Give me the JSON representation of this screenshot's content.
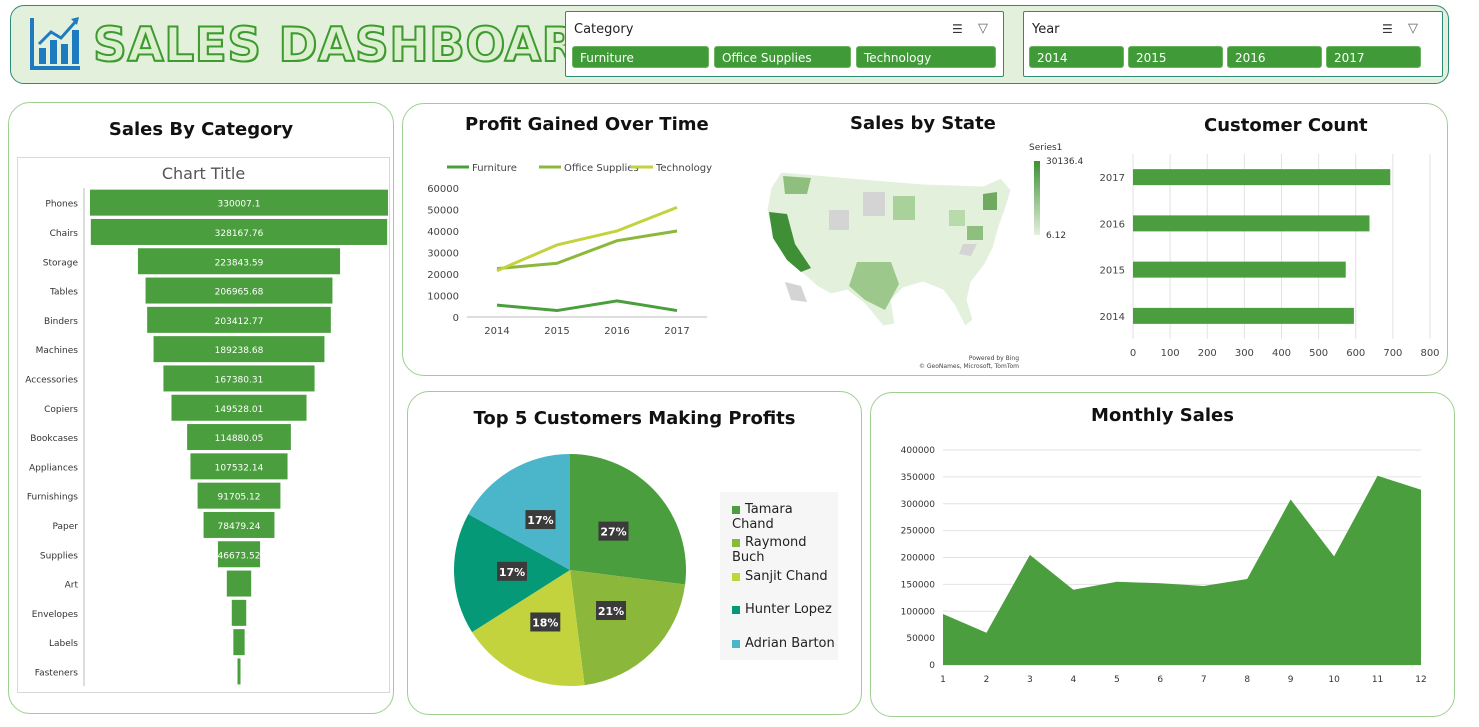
{
  "header": {
    "title": "SALES DASHBOARD",
    "category_slicer": {
      "title": "Category",
      "items": [
        "Furniture",
        "Office Supplies",
        "Technology"
      ]
    },
    "year_slicer": {
      "title": "Year",
      "items": [
        "2014",
        "2015",
        "2016",
        "2017"
      ]
    }
  },
  "colors": {
    "green": "#4a9e3d",
    "mid_green": "#8bb83a",
    "light_green": "#c3d33e",
    "teal": "#069978",
    "sky": "#4bb5c9",
    "map_dark": "#3f8f36",
    "map_light": "#e3f1dc"
  },
  "icons": [
    "bar-chart-logo-icon",
    "multi-select-icon",
    "clear-filter-icon"
  ],
  "chart_data": [
    {
      "id": "sales_by_category",
      "type": "bar",
      "panel_title": "Sales By Category",
      "title": "Chart Title",
      "orientation": "horizontal-funnel",
      "categories": [
        "Phones",
        "Chairs",
        "Storage",
        "Tables",
        "Binders",
        "Machines",
        "Accessories",
        "Copiers",
        "Bookcases",
        "Appliances",
        "Furnishings",
        "Paper",
        "Supplies",
        "Art",
        "Envelopes",
        "Labels",
        "Fasteners"
      ],
      "values": [
        330007.1,
        328167.76,
        223843.59,
        206965.68,
        203412.77,
        189238.68,
        167380.31,
        149528.01,
        114880.05,
        107532.14,
        91705.12,
        78479.24,
        46673.52,
        27000,
        16000,
        12500,
        3000
      ],
      "labels": [
        "330007.1",
        "328167.76",
        "223843.59",
        "206965.68",
        "203412.77",
        "189238.68",
        "167380.31",
        "149528.01",
        "114880.05",
        "107532.14",
        "91705.12",
        "78479.24",
        "46673.52",
        "",
        "",
        "",
        ""
      ]
    },
    {
      "id": "profit_over_time",
      "type": "line",
      "title": "Profit Gained Over Time",
      "x": [
        "2014",
        "2015",
        "2016",
        "2017"
      ],
      "ylim": [
        0,
        60000
      ],
      "yticks": [
        "0",
        "10000",
        "20000",
        "30000",
        "40000",
        "50000",
        "60000"
      ],
      "legend_position": "top",
      "series": [
        {
          "name": "Furniture",
          "values": [
            5500,
            3000,
            7500,
            3000
          ]
        },
        {
          "name": "Office Supplies",
          "values": [
            22500,
            25000,
            35500,
            40000
          ]
        },
        {
          "name": "Technology",
          "values": [
            21500,
            33500,
            40000,
            51000
          ]
        }
      ]
    },
    {
      "id": "sales_by_state",
      "type": "heatmap",
      "title": "Sales by State",
      "legend_title": "Series1",
      "legend_max": "30136.4",
      "legend_min": "6.12",
      "attribution": [
        "Powered by Bing",
        "© GeoNames, Microsoft, TomTom"
      ]
    },
    {
      "id": "customer_count",
      "type": "bar",
      "title": "Customer Count",
      "orientation": "horizontal",
      "categories": [
        "2017",
        "2016",
        "2015",
        "2014"
      ],
      "values": [
        693,
        637,
        573,
        595
      ],
      "xlim": [
        0,
        800
      ],
      "xticks": [
        "0",
        "100",
        "200",
        "300",
        "400",
        "500",
        "600",
        "700",
        "800"
      ]
    },
    {
      "id": "top5_customers",
      "type": "pie",
      "title": "Top 5 Customers Making Profits",
      "legend_position": "right",
      "slices": [
        {
          "name": "Tamara Chand",
          "value": 27,
          "label": "27%"
        },
        {
          "name": "Raymond Buch",
          "value": 21,
          "label": "21%"
        },
        {
          "name": "Sanjit Chand",
          "value": 18,
          "label": "18%"
        },
        {
          "name": "Hunter Lopez",
          "value": 17,
          "label": "17%"
        },
        {
          "name": "Adrian Barton",
          "value": 17,
          "label": "17%"
        }
      ]
    },
    {
      "id": "monthly_sales",
      "type": "area",
      "title": "Monthly Sales",
      "x": [
        1,
        2,
        3,
        4,
        5,
        6,
        7,
        8,
        9,
        10,
        11,
        12
      ],
      "values": [
        95000,
        60000,
        205000,
        140000,
        155000,
        152000,
        147000,
        160000,
        308000,
        202000,
        352000,
        326000
      ],
      "ylim": [
        0,
        400000
      ],
      "yticks": [
        "0",
        "50000",
        "100000",
        "150000",
        "200000",
        "250000",
        "300000",
        "350000",
        "400000"
      ]
    }
  ]
}
